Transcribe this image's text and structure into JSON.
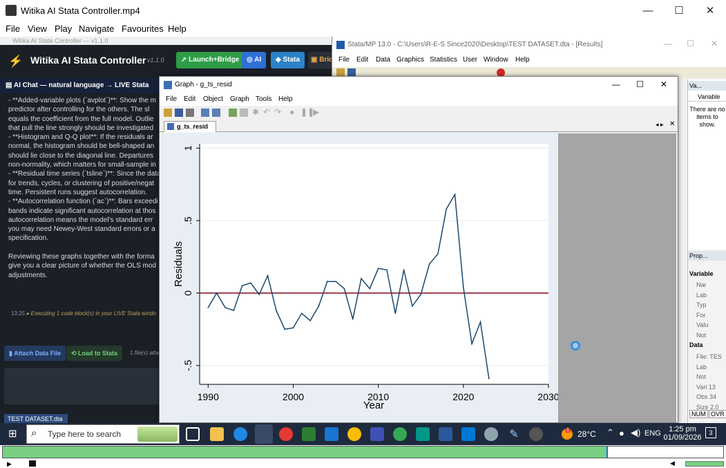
{
  "player": {
    "title": "Witika AI Stata Controller.mp4",
    "menu": [
      "File",
      "View",
      "Play",
      "Navigate",
      "Favourites",
      "Help"
    ],
    "progress_fraction": 0.838
  },
  "witika": {
    "top_text": "Witika AI Stata Controller — v1.1.0",
    "title": "Witika AI Stata Controller",
    "version": "v1.1.0",
    "buttons": {
      "launch": "Launch+Bridge",
      "ai": "AI",
      "stata": "Stata",
      "bridge": "Brid"
    },
    "chat_header": "AI Chat — natural language → LIVE Stata",
    "chat_text": "- **Added-variable plots (`avplot`)**: Show the m\npredictor after controlling for the others. The sl\nequals the coefficient from the full model. Outlie\nthat pull the line strongly should be investigated\n- **Histogram and Q-Q plot**: If the residuals ar\nnormal, the histogram should be bell-shaped an\nshould lie close to the diagonal line. Departures\nnon-normality, which matters for small-sample in\n- **Residual time series (`tsline`)**: Since the data\nfor trends, cycles, or clustering of positive/negat\ntime. Persistent runs suggest autocorrelation.\n- **Autocorrelation function (`ac`)**: Bars exceedi\nbands indicate significant autocorrelation at thos\nautocorrelation means the model's standard err\nyou may need Newey-West standard errors or a\nspecification.\n\nReviewing these graphs together with the forma\ngive you a clear picture of whether the OLS mod\nadjustments.",
    "exec_time": "13:25",
    "exec_text": "Executing 1 code block(s) in your LIVE Stata windo",
    "attach_btn": "Attach Data File",
    "load_btn": "Load to Stata",
    "files_text": "1 file(s) atta",
    "bottom_tab": "TEST DATASET.dta"
  },
  "stata": {
    "title": "Stata/MP 13.0 - C:\\Users\\R-E-S Since2020\\Desktop\\TEST DATASET.dta - [Results]",
    "menu": [
      "File",
      "Edit",
      "Data",
      "Graphics",
      "Statistics",
      "User",
      "Window",
      "Help"
    ],
    "var_panel_title": "Va...",
    "var_col": "Variable",
    "no_items": "There are no items to show.",
    "prop_title": "Prop...",
    "var_section": "Variable",
    "var_rows": [
      "Nar",
      "Lab",
      "Typ",
      "For",
      "Valu",
      "Not"
    ],
    "data_section": "Data",
    "data_rows": [
      "File: TES",
      "Lab",
      "Not",
      "Vari 13",
      "Obs 34",
      "Size 2.0"
    ],
    "status_num": "NUM",
    "status_ovr": "OVR"
  },
  "graph": {
    "window_title": "Graph - g_ts_resid",
    "menu": [
      "File",
      "Edit",
      "Object",
      "Graph",
      "Tools",
      "Help"
    ],
    "tab": "g_ts_resid"
  },
  "chart_data": {
    "type": "line",
    "xlabel": "Year",
    "ylabel": "Residuals",
    "xlim": [
      1989,
      2030
    ],
    "ylim": [
      -0.63,
      1.03
    ],
    "xticks": [
      "1990",
      "2000",
      "2010",
      "2020",
      "2030"
    ],
    "yticks": [
      "-.5",
      "0",
      ".5",
      "1"
    ],
    "reference_line_y": 0,
    "x": [
      1990,
      1991,
      1992,
      1993,
      1994,
      1995,
      1996,
      1997,
      1998,
      1999,
      2000,
      2001,
      2002,
      2003,
      2004,
      2005,
      2006,
      2007,
      2008,
      2009,
      2010,
      2011,
      2012,
      2013,
      2014,
      2015,
      2016,
      2017,
      2018,
      2019,
      2020,
      2021,
      2022,
      2023
    ],
    "values": [
      -0.1,
      0.0,
      -0.1,
      -0.12,
      0.05,
      0.07,
      -0.01,
      0.12,
      -0.12,
      -0.25,
      -0.24,
      -0.14,
      -0.19,
      -0.09,
      0.08,
      0.08,
      0.03,
      -0.18,
      0.1,
      0.03,
      0.17,
      0.16,
      -0.14,
      0.16,
      -0.09,
      -0.01,
      0.2,
      0.27,
      0.58,
      0.68,
      0.04,
      -0.35,
      -0.2,
      -0.59
    ]
  },
  "taskbar": {
    "search_placeholder": "Type here to search",
    "temp": "28°C",
    "lang": "ENG",
    "time": "1:25 pm",
    "date": "01/09/2026",
    "notif": "3",
    "weather_badge": "1"
  }
}
